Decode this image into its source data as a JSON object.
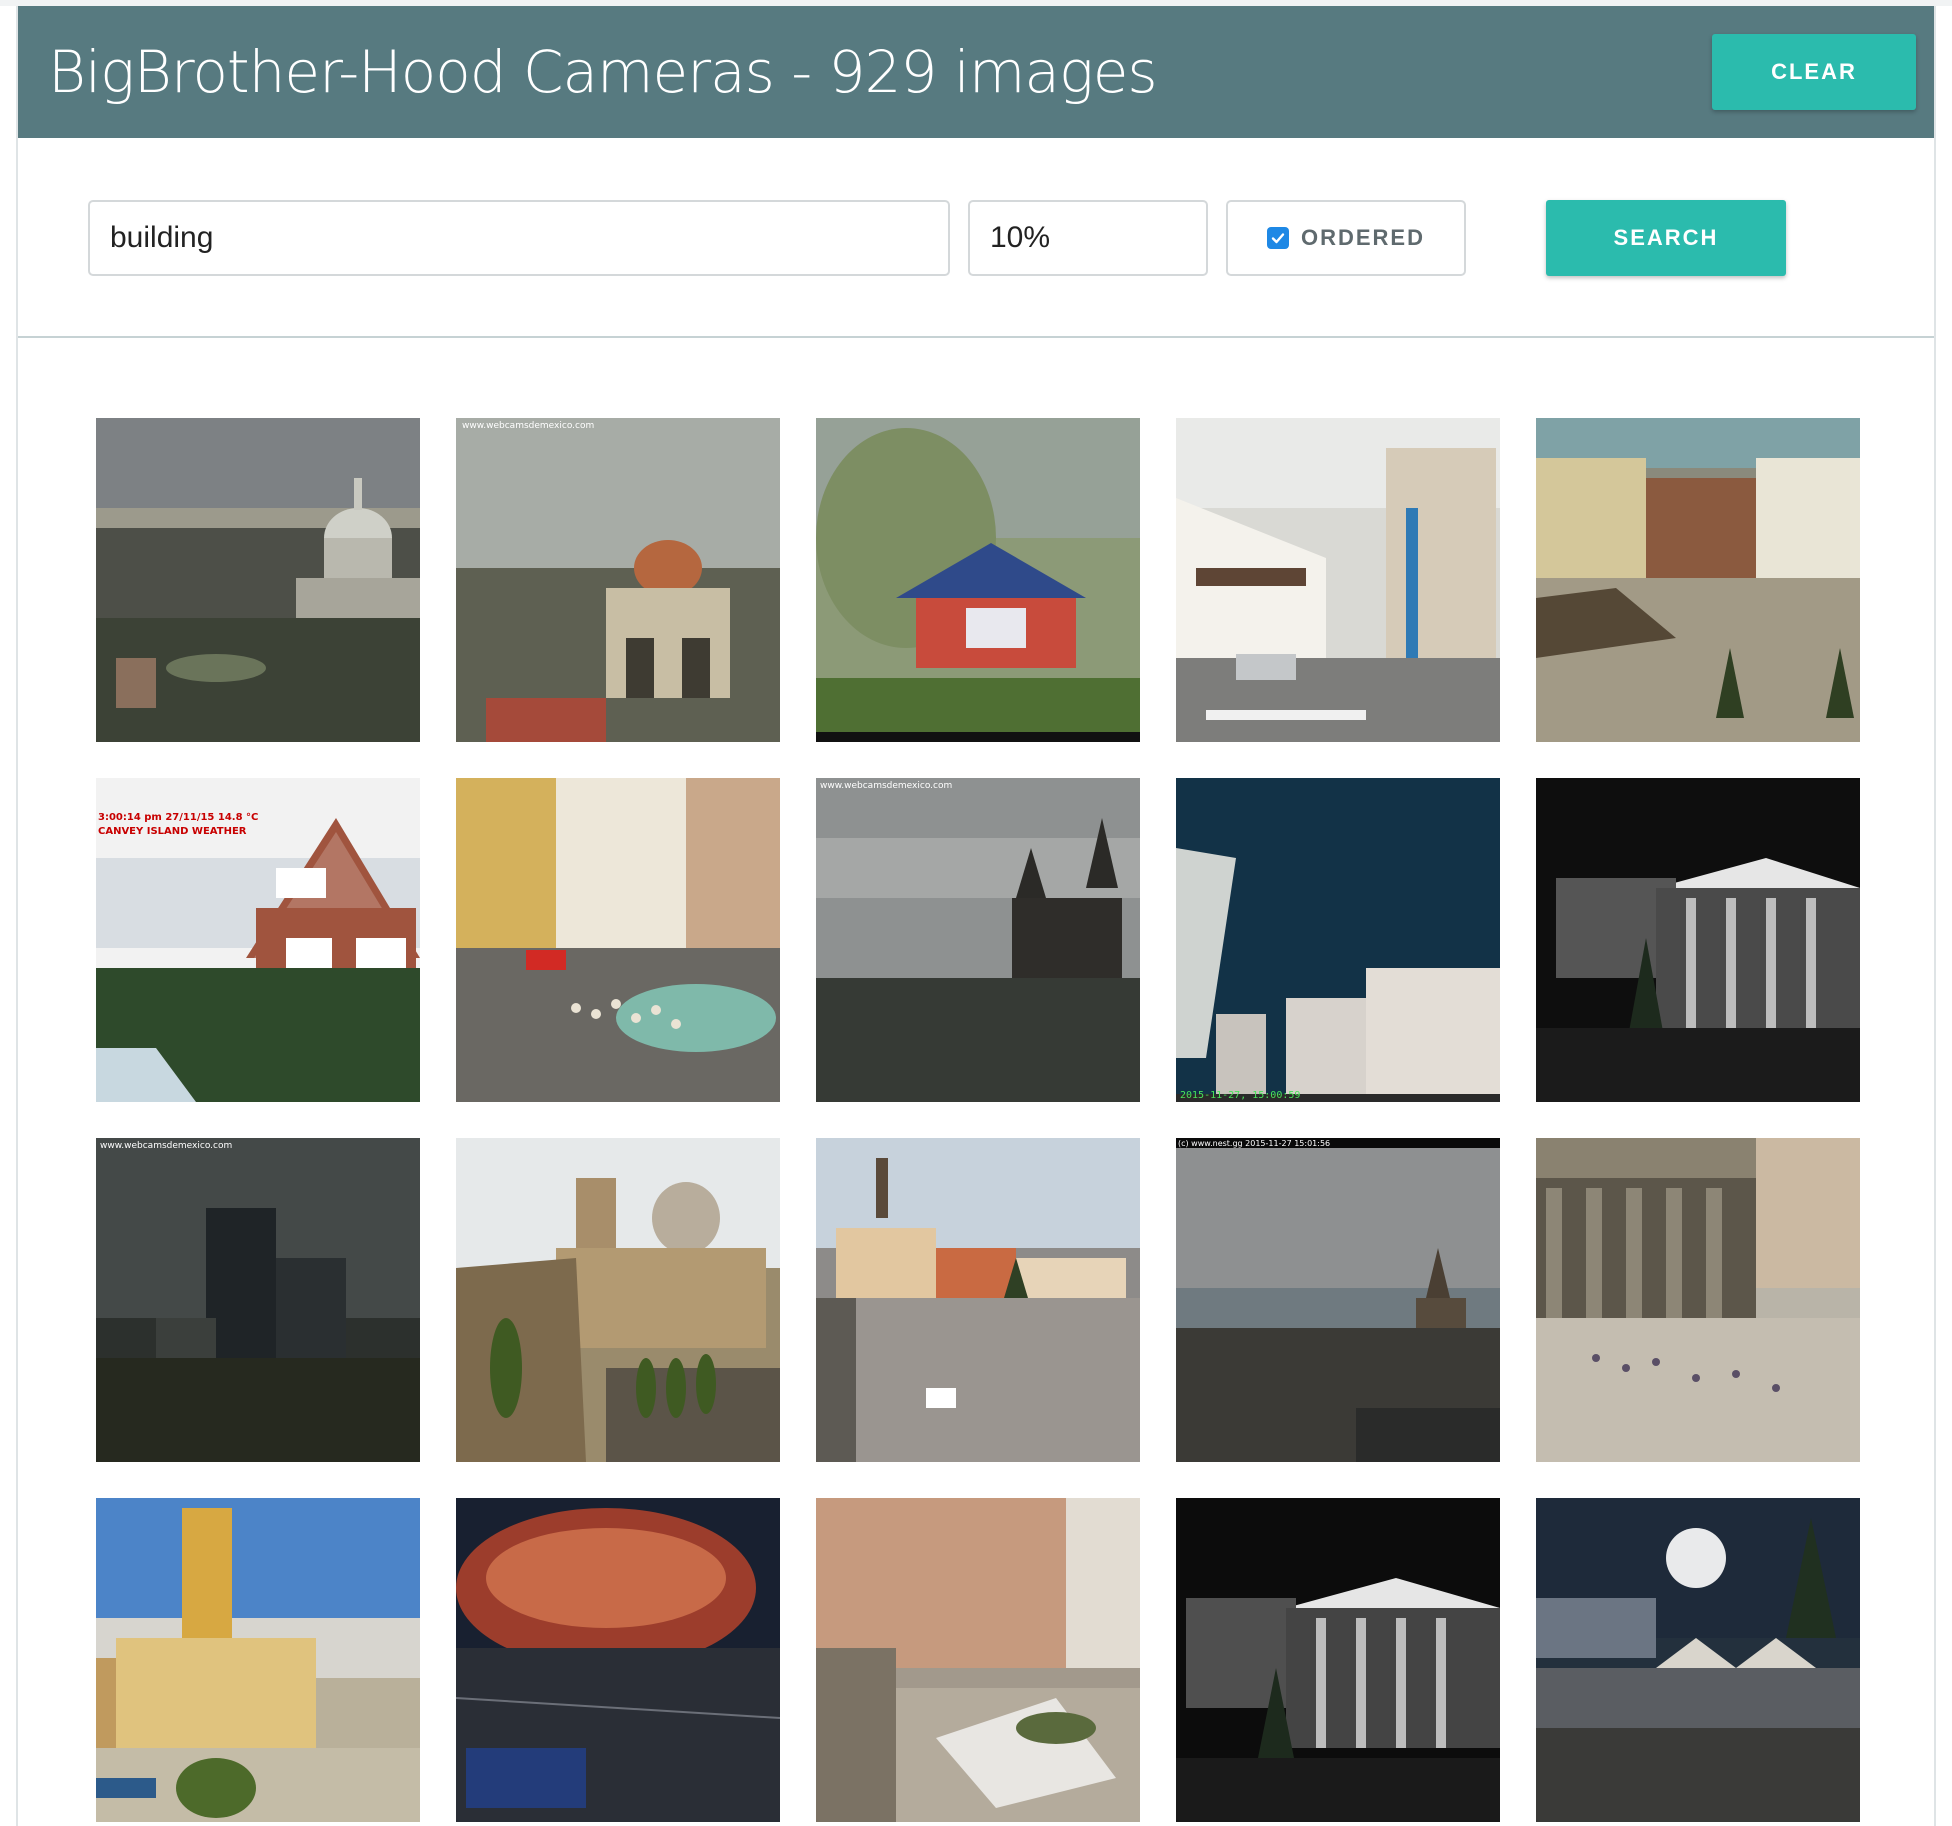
{
  "header": {
    "title": "BigBrother-Hood Cameras - 929 images",
    "clear_label": "CLEAR"
  },
  "search": {
    "query_value": "building",
    "percent_value": "10%",
    "ordered_label": "ORDERED",
    "ordered_checked": true,
    "search_label": "SEARCH"
  },
  "images": [
    {
      "name": "thumb-rome-vatican-dome",
      "caption": ""
    },
    {
      "name": "thumb-mexico-monument-revolution",
      "caption": "www.webcamsdemexico.com"
    },
    {
      "name": "thumb-alpine-red-cabin",
      "caption": ""
    },
    {
      "name": "thumb-tyrol-village-street",
      "caption": ""
    },
    {
      "name": "thumb-town-square-dusk",
      "caption": ""
    },
    {
      "name": "thumb-canvey-island-house",
      "caption": "3:00:14 pm 27/11/15 14.8 °C CANVEY ISLAND WEATHER"
    },
    {
      "name": "thumb-rome-piazza-fountain",
      "caption": ""
    },
    {
      "name": "thumb-mexico-cathedral-spires",
      "caption": "www.webcamsdemexico.com"
    },
    {
      "name": "thumb-apartment-blocks-night",
      "caption": "2015-11-27, 15:00:59"
    },
    {
      "name": "thumb-classical-building-night",
      "caption": ""
    },
    {
      "name": "thumb-mexico-skyscraper-fog",
      "caption": "www.webcamsdemexico.com"
    },
    {
      "name": "thumb-assisi-basilica",
      "caption": ""
    },
    {
      "name": "thumb-town-square-christmas-tree",
      "caption": ""
    },
    {
      "name": "thumb-harbour-church-overcast",
      "caption": "(c) www.nest.gg 2015-11-27 15:01:56"
    },
    {
      "name": "thumb-rome-pantheon",
      "caption": ""
    },
    {
      "name": "thumb-spanish-church-tower",
      "caption": ""
    },
    {
      "name": "thumb-glass-arena-night",
      "caption": ""
    },
    {
      "name": "thumb-rome-trevi-area",
      "caption": ""
    },
    {
      "name": "thumb-classical-building-night-2",
      "caption": ""
    },
    {
      "name": "thumb-christmas-market-night",
      "caption": ""
    }
  ]
}
